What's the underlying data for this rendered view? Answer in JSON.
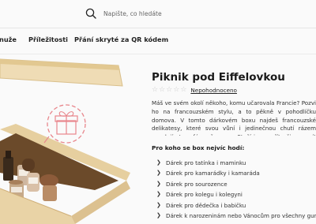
{
  "search": {
    "placeholder": "Napište, co hledáte"
  },
  "nav": {
    "items": [
      {
        "label": "nuže"
      },
      {
        "label": "Příležitosti"
      },
      {
        "label": "Přání skryté za QR kódem"
      }
    ]
  },
  "product": {
    "title": "Piknik pod Eiffelovkou",
    "stars": 5,
    "rating_label": "Nepohodnoceno",
    "description": "Máš ve svém okolí někoho, komu učarovala Francie? Pozvi ho na francouzském stylu, a to pěkně v pohodlíčku domova. V tomto dárkovém boxu najdeš francouzské delikatesy, které svou vůní i jedinečnou chutí rázem vyvolají atmosféru přenesou. Stačí jen zavřít oči a zasnít se.",
    "for_whom_title": "Pro koho se box nejvíc hodí:",
    "for_whom": [
      "Dárek pro tatínka i maminku",
      "Dárek pro kamarádky i kamaráda",
      "Dárek pro sourozence",
      "Dárek pro kolegu i kolegyni",
      "Dárek pro dědečka i babičku",
      "Dárek k narozeninám nebo Vánocům pro všechny gurmány"
    ]
  },
  "colors": {
    "accent": "#e8868c",
    "box_wood": "#e9d3a6",
    "text": "#222222"
  }
}
